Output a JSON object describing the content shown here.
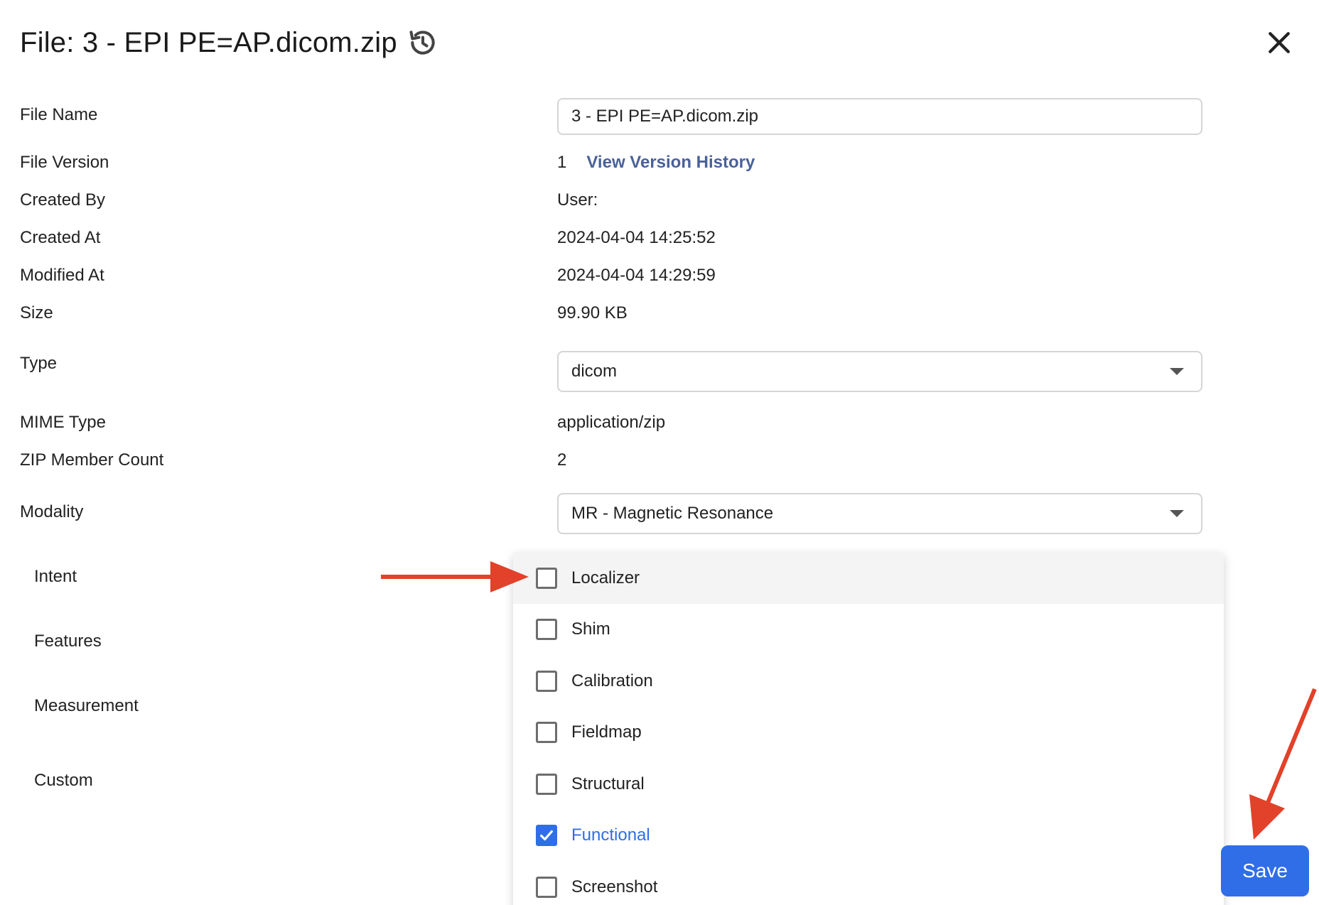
{
  "dialog": {
    "title": "File: 3 - EPI PE=AP.dicom.zip"
  },
  "fields": {
    "file_name_label": "File Name",
    "file_name_value": "3 - EPI PE=AP.dicom.zip",
    "file_version_label": "File Version",
    "file_version_value": "1",
    "view_version_history": "View Version History",
    "created_by_label": "Created By",
    "created_by_value": "User:",
    "created_at_label": "Created At",
    "created_at_value": "2024-04-04 14:25:52",
    "modified_at_label": "Modified At",
    "modified_at_value": "2024-04-04 14:29:59",
    "size_label": "Size",
    "size_value": "99.90 KB",
    "type_label": "Type",
    "type_value": "dicom",
    "mime_label": "MIME Type",
    "mime_value": "application/zip",
    "zip_count_label": "ZIP Member Count",
    "zip_count_value": "2",
    "modality_label": "Modality",
    "modality_value": "MR - Magnetic Resonance"
  },
  "classification": {
    "intent_label": "Intent",
    "features_label": "Features",
    "measurement_label": "Measurement",
    "custom_label": "Custom"
  },
  "intent_options": [
    {
      "label": "Localizer",
      "checked": false
    },
    {
      "label": "Shim",
      "checked": false
    },
    {
      "label": "Calibration",
      "checked": false
    },
    {
      "label": "Fieldmap",
      "checked": false
    },
    {
      "label": "Structural",
      "checked": false
    },
    {
      "label": "Functional",
      "checked": true
    },
    {
      "label": "Screenshot",
      "checked": false
    }
  ],
  "actions": {
    "save_label": "Save"
  },
  "colors": {
    "primary": "#2f6ee6",
    "link": "#4a6199",
    "annotation_arrow": "#e2412a"
  }
}
